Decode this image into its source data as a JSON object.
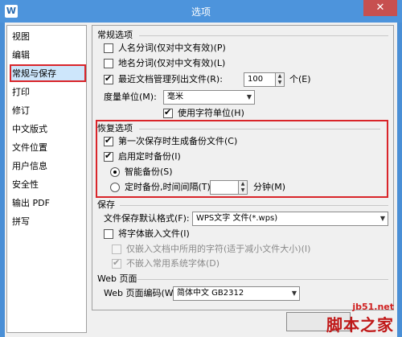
{
  "window": {
    "title": "选项",
    "app_icon_letter": "W",
    "close_glyph": "✕"
  },
  "sidebar": {
    "items": [
      {
        "label": "视图"
      },
      {
        "label": "编辑"
      },
      {
        "label": "常规与保存",
        "selected": true
      },
      {
        "label": "打印"
      },
      {
        "label": "修订"
      },
      {
        "label": "中文版式"
      },
      {
        "label": "文件位置"
      },
      {
        "label": "用户信息"
      },
      {
        "label": "安全性"
      },
      {
        "label": "输出 PDF"
      },
      {
        "label": "拼写"
      }
    ]
  },
  "general": {
    "title": "常规选项",
    "person_name": {
      "label": "人名分词(仅对中文有效)(P)",
      "checked": false
    },
    "place_name": {
      "label": "地名分词(仅对中文有效)(L)",
      "checked": false
    },
    "recent_docs": {
      "label": "最近文档管理列出文件(R):",
      "value": "100",
      "unit": "个(E)",
      "checked": true
    },
    "measure_unit": {
      "label": "度量单位(M):",
      "value": "毫米"
    },
    "char_unit": {
      "label": "使用字符单位(H)",
      "checked": true
    }
  },
  "recovery": {
    "title": "恢复选项",
    "first_backup": {
      "label": "第一次保存时生成备份文件(C)",
      "checked": true
    },
    "timed_backup": {
      "label": "启用定时备份(I)",
      "checked": true
    },
    "smart_backup": {
      "label": "智能备份(S)",
      "selected": true
    },
    "interval_backup": {
      "label": "定时备份,时间间隔(T):",
      "value": "",
      "unit": "分钟(M)",
      "selected": false
    }
  },
  "save": {
    "title": "保存",
    "format": {
      "label": "文件保存默认格式(F):",
      "value": "WPS文字 文件(*.wps)"
    },
    "embed_fonts": {
      "label": "将字体嵌入文件(I)",
      "checked": false
    },
    "embed_used_only": {
      "label": "仅嵌入文档中所用的字符(适于减小文件大小)(I)",
      "checked": false
    },
    "no_system_fonts": {
      "label": "不嵌入常用系统字体(D)",
      "checked": true
    }
  },
  "web": {
    "title": "Web 页面",
    "encoding": {
      "label": "Web 页面编码(W):",
      "value": "简体中文 GB2312"
    }
  },
  "watermark": {
    "url": "jb51.net",
    "name": "脚本之家"
  },
  "colors": {
    "title_bar": "#4d94dc",
    "highlight_border": "#d9252a",
    "selected_bg": "#cde6fb"
  }
}
